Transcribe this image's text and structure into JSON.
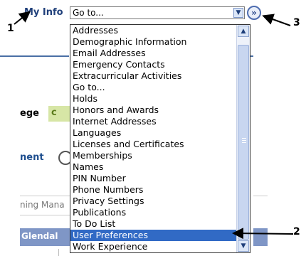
{
  "header": {
    "label": "My Info"
  },
  "select": {
    "value": "Go to..."
  },
  "dropdown": {
    "options": [
      "Addresses",
      "Demographic Information",
      "Email Addresses",
      "Emergency Contacts",
      "Extracurricular Activities",
      "Go to...",
      "Holds",
      "Honors and Awards",
      "Internet Addresses",
      "Languages",
      "Licenses and Certificates",
      "Memberships",
      "Names",
      "PIN Number",
      "Phone Numbers",
      "Privacy Settings",
      "Publications",
      "To Do List",
      "User Preferences",
      "Work Experience"
    ],
    "selected": "User Preferences"
  },
  "background": {
    "college_fragment": "ege",
    "green_fragment": "c",
    "enrollment_fragment": "nent",
    "training_fragment": "ning Mana",
    "campus_fragment": "Glendal"
  },
  "callouts": {
    "one": "1",
    "two": "2",
    "three": "3"
  },
  "colors": {
    "highlight": "#316ac5",
    "band": "#7f96c6"
  }
}
